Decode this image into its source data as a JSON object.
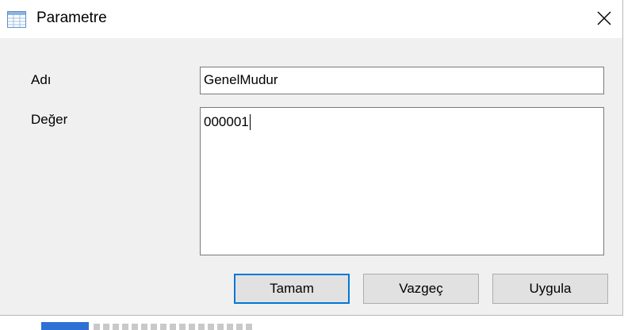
{
  "dialog": {
    "title": "Parametre",
    "icon": "table-icon",
    "close_icon": "close-icon"
  },
  "form": {
    "name_label": "Adı",
    "name_value": "GenelMudur",
    "value_label": "Değer",
    "value_value": "000001"
  },
  "buttons": {
    "ok_label": "Tamam",
    "cancel_label": "Vazgeç",
    "apply_label": "Uygula"
  },
  "colors": {
    "accent": "#0078d7",
    "dialog_bg": "#f0f0f0",
    "button_bg": "#e1e1e1"
  }
}
